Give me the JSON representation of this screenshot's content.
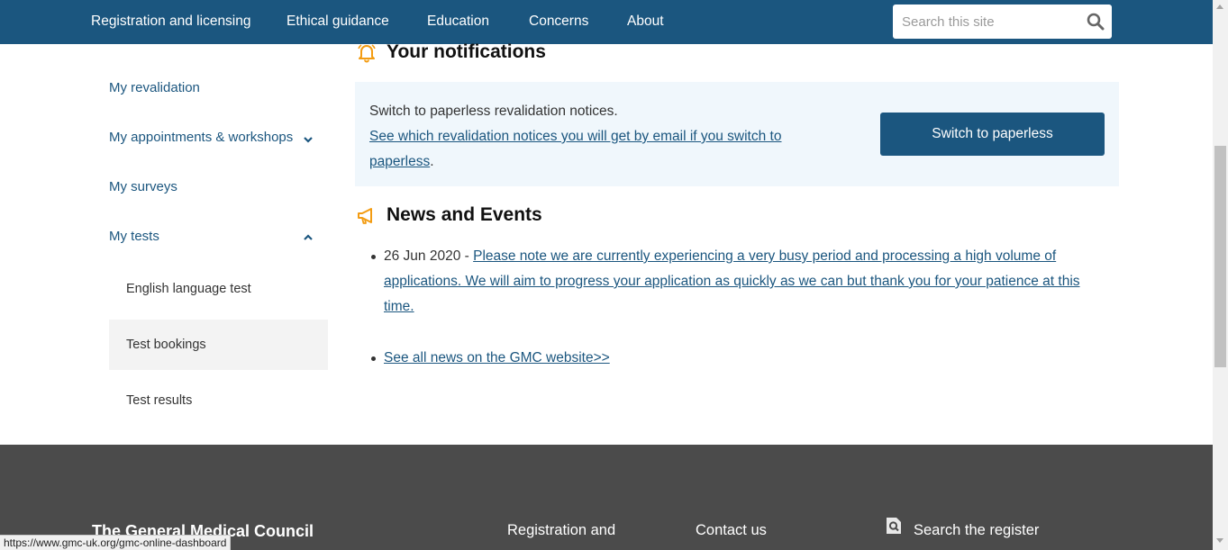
{
  "nav": {
    "items": [
      {
        "label": "Registration and licensing"
      },
      {
        "label": "Ethical guidance"
      },
      {
        "label": "Education"
      },
      {
        "label": "Concerns"
      },
      {
        "label": "About"
      }
    ],
    "search_placeholder": "Search this site"
  },
  "sidebar": {
    "items": [
      {
        "label": "My revalidation"
      },
      {
        "label": "My appointments & workshops"
      },
      {
        "label": "My surveys"
      },
      {
        "label": "My tests"
      }
    ],
    "sub_items": [
      {
        "label": "English language test"
      },
      {
        "label": "Test bookings"
      },
      {
        "label": "Test results"
      }
    ]
  },
  "notifications": {
    "title": "Your notifications",
    "text": "Switch to paperless revalidation notices.",
    "link": "See which revalidation notices you will get by email if you switch to paperless",
    "link_suffix": ".",
    "button": "Switch to paperless"
  },
  "news": {
    "title": "News and Events",
    "items": [
      {
        "date": "26 Jun 2020 - ",
        "text": "Please note we are currently experiencing a very busy period and processing a high volume of applications. We will aim to progress your application as quickly as we can but thank you for your patience at this time."
      }
    ],
    "all_link": "See all news on the GMC website>>"
  },
  "footer": {
    "title": "The General Medical Council",
    "col1": "Registration and",
    "col2": "Contact us",
    "col3": "Search the register"
  },
  "status_url": "https://www.gmc-uk.org/gmc-online-dashboard",
  "colors": {
    "brand": "#1b567f",
    "accent": "#f39c12",
    "footer": "#4b4b4b",
    "panel": "#f0f7fc"
  }
}
